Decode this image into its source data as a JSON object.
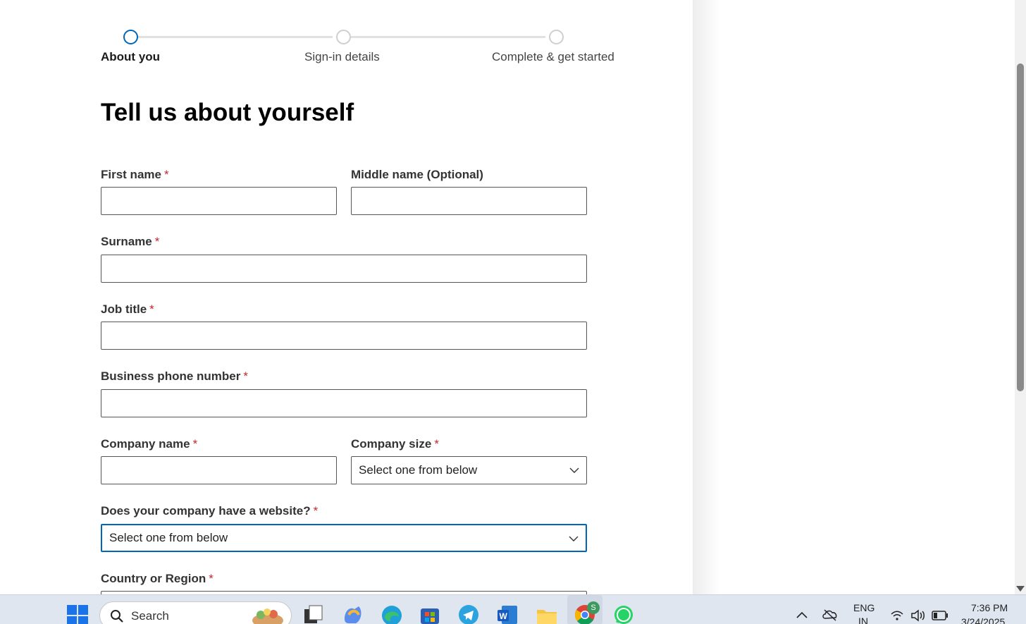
{
  "stepper": {
    "steps": [
      {
        "label": "About you",
        "active": true
      },
      {
        "label": "Sign-in details",
        "active": false
      },
      {
        "label": "Complete & get started",
        "active": false
      }
    ]
  },
  "page_title": "Tell us about yourself",
  "required_marker": "*",
  "fields": {
    "first_name": {
      "label": "First name",
      "value": ""
    },
    "middle_name": {
      "label": "Middle name (Optional)",
      "value": ""
    },
    "surname": {
      "label": "Surname",
      "value": ""
    },
    "job_title": {
      "label": "Job title",
      "value": ""
    },
    "business_phone": {
      "label": "Business phone number",
      "value": ""
    },
    "company_name": {
      "label": "Company name",
      "value": ""
    },
    "company_size": {
      "label": "Company size",
      "selected": "Select one from below"
    },
    "website": {
      "label": "Does your company have a website?",
      "selected": "Select one from below"
    },
    "country": {
      "label": "Country or Region"
    }
  },
  "taskbar": {
    "search_placeholder": "Search",
    "language": "ENG",
    "region": "IN",
    "time": "7:36 PM",
    "date": "3/24/2025",
    "chrome_badge": "S"
  },
  "colors": {
    "accent": "#0067b8",
    "required": "#c4262e",
    "taskbar_bg": "#dfe6ef"
  }
}
